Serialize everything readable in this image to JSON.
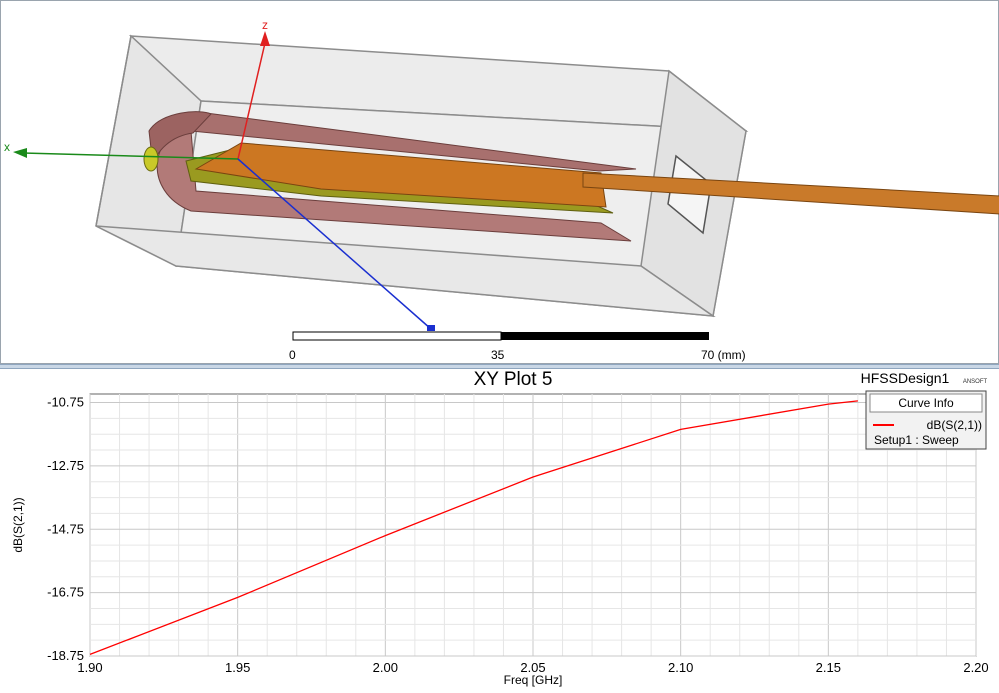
{
  "viewport": {
    "axis_z_label": "z",
    "axis_x_label": "x",
    "scale_labels": [
      "0",
      "35",
      "70 (mm)"
    ]
  },
  "plot": {
    "title": "XY Plot 5",
    "design_name": "HFSSDesign1",
    "logo_text": "ANSOFT",
    "legend_title": "Curve Info",
    "legend_entries": [
      {
        "name": "dB(S(2,1))",
        "subtitle": "Setup1 : Sweep",
        "color": "#ff0000"
      }
    ]
  },
  "chart_data": {
    "type": "line",
    "title": "XY Plot 5",
    "xlabel": "Freq [GHz]",
    "ylabel": "dB(S(2,1))",
    "xlim": [
      1.9,
      2.2
    ],
    "ylim": [
      -18.75,
      -9.5
    ],
    "x_ticks": [
      "1.90",
      "1.95",
      "2.00",
      "2.05",
      "2.10",
      "2.15",
      "2.20"
    ],
    "y_ticks": [
      "-10.75",
      "-12.75",
      "-14.75",
      "-16.75",
      "-18.75"
    ],
    "grid": true,
    "legend_position": "top-right",
    "series": [
      {
        "name": "dB(S(2,1))",
        "color": "#ff0000",
        "x": [
          1.9,
          1.95,
          2.0,
          2.05,
          2.1,
          2.15,
          2.16
        ],
        "y": [
          -18.7,
          -16.9,
          -14.95,
          -13.1,
          -11.6,
          -10.8,
          -10.7
        ]
      }
    ]
  }
}
